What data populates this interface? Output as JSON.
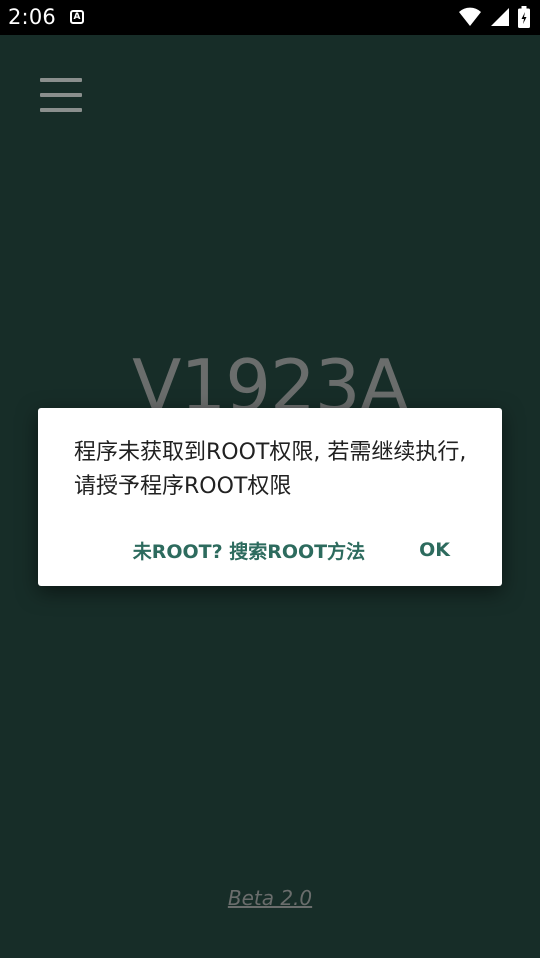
{
  "status_bar": {
    "time": "2:06",
    "notification_glyph": "A",
    "icons": [
      "wifi-icon",
      "signal-icon",
      "battery-icon"
    ]
  },
  "app": {
    "device_name": "V1923A",
    "version_link": "Beta 2.0"
  },
  "dialog": {
    "message": "程序未获取到ROOT权限, 若需继续执行, 请授予程序ROOT权限",
    "search_button": "未ROOT? 搜索ROOT方法",
    "ok_button": "OK"
  },
  "colors": {
    "background": "#172d28",
    "accent": "#2d6b5e",
    "muted_text": "#6a6d6c"
  }
}
